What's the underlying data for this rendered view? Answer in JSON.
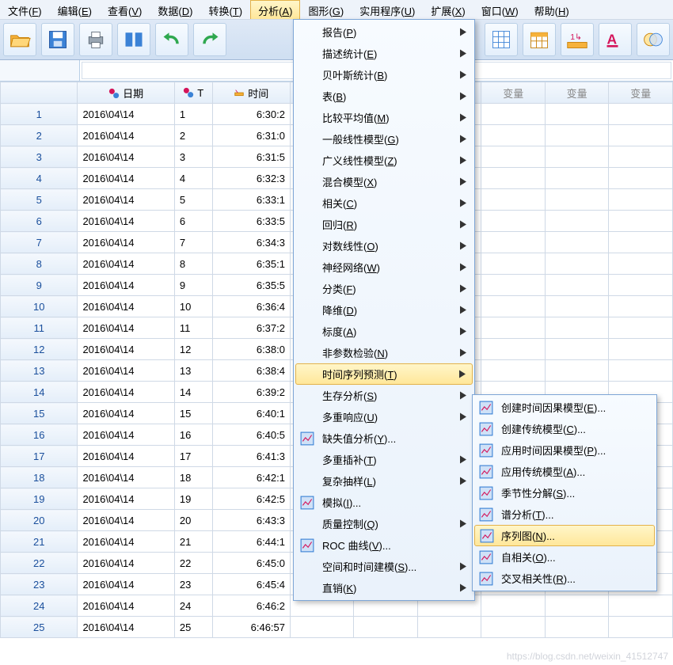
{
  "menubar": [
    {
      "label": "文件(",
      "key": "F",
      "tail": ")"
    },
    {
      "label": "编辑(",
      "key": "E",
      "tail": ")"
    },
    {
      "label": "查看(",
      "key": "V",
      "tail": ")"
    },
    {
      "label": "数据(",
      "key": "D",
      "tail": ")"
    },
    {
      "label": "转换(",
      "key": "T",
      "tail": ")"
    },
    {
      "label": "分析(",
      "key": "A",
      "tail": ")",
      "open": true
    },
    {
      "label": "图形(",
      "key": "G",
      "tail": ")"
    },
    {
      "label": "实用程序(",
      "key": "U",
      "tail": ")"
    },
    {
      "label": "扩展(",
      "key": "X",
      "tail": ")"
    },
    {
      "label": "窗口(",
      "key": "W",
      "tail": ")"
    },
    {
      "label": "帮助(",
      "key": "H",
      "tail": ")"
    }
  ],
  "grid": {
    "headers": {
      "date": "日期",
      "t": "T",
      "time": "时间",
      "var": "变量"
    },
    "rows": [
      {
        "n": "1",
        "date": "2016\\04\\14",
        "t": "1",
        "time": "6:30:2"
      },
      {
        "n": "2",
        "date": "2016\\04\\14",
        "t": "2",
        "time": "6:31:0"
      },
      {
        "n": "3",
        "date": "2016\\04\\14",
        "t": "3",
        "time": "6:31:5"
      },
      {
        "n": "4",
        "date": "2016\\04\\14",
        "t": "4",
        "time": "6:32:3"
      },
      {
        "n": "5",
        "date": "2016\\04\\14",
        "t": "5",
        "time": "6:33:1"
      },
      {
        "n": "6",
        "date": "2016\\04\\14",
        "t": "6",
        "time": "6:33:5"
      },
      {
        "n": "7",
        "date": "2016\\04\\14",
        "t": "7",
        "time": "6:34:3"
      },
      {
        "n": "8",
        "date": "2016\\04\\14",
        "t": "8",
        "time": "6:35:1"
      },
      {
        "n": "9",
        "date": "2016\\04\\14",
        "t": "9",
        "time": "6:35:5"
      },
      {
        "n": "10",
        "date": "2016\\04\\14",
        "t": "10",
        "time": "6:36:4"
      },
      {
        "n": "11",
        "date": "2016\\04\\14",
        "t": "11",
        "time": "6:37:2"
      },
      {
        "n": "12",
        "date": "2016\\04\\14",
        "t": "12",
        "time": "6:38:0"
      },
      {
        "n": "13",
        "date": "2016\\04\\14",
        "t": "13",
        "time": "6:38:4"
      },
      {
        "n": "14",
        "date": "2016\\04\\14",
        "t": "14",
        "time": "6:39:2"
      },
      {
        "n": "15",
        "date": "2016\\04\\14",
        "t": "15",
        "time": "6:40:1"
      },
      {
        "n": "16",
        "date": "2016\\04\\14",
        "t": "16",
        "time": "6:40:5"
      },
      {
        "n": "17",
        "date": "2016\\04\\14",
        "t": "17",
        "time": "6:41:3"
      },
      {
        "n": "18",
        "date": "2016\\04\\14",
        "t": "18",
        "time": "6:42:1"
      },
      {
        "n": "19",
        "date": "2016\\04\\14",
        "t": "19",
        "time": "6:42:5"
      },
      {
        "n": "20",
        "date": "2016\\04\\14",
        "t": "20",
        "time": "6:43:3"
      },
      {
        "n": "21",
        "date": "2016\\04\\14",
        "t": "21",
        "time": "6:44:1"
      },
      {
        "n": "22",
        "date": "2016\\04\\14",
        "t": "22",
        "time": "6:45:0"
      },
      {
        "n": "23",
        "date": "2016\\04\\14",
        "t": "23",
        "time": "6:45:4"
      },
      {
        "n": "24",
        "date": "2016\\04\\14",
        "t": "24",
        "time": "6:46:2"
      },
      {
        "n": "25",
        "date": "2016\\04\\14",
        "t": "25",
        "time": "6:46:57"
      }
    ]
  },
  "menu_analyze": [
    {
      "label": "报告(",
      "key": "P",
      "tail": ")",
      "sub": true
    },
    {
      "label": "描述统计(",
      "key": "E",
      "tail": ")",
      "sub": true
    },
    {
      "label": "贝叶斯统计(",
      "key": "B",
      "tail": ")",
      "sub": true
    },
    {
      "label": "表(",
      "key": "B",
      "tail": ")",
      "sub": true
    },
    {
      "label": "比较平均值(",
      "key": "M",
      "tail": ")",
      "sub": true
    },
    {
      "label": "一般线性模型(",
      "key": "G",
      "tail": ")",
      "sub": true
    },
    {
      "label": "广义线性模型(",
      "key": "Z",
      "tail": ")",
      "sub": true
    },
    {
      "label": "混合模型(",
      "key": "X",
      "tail": ")",
      "sub": true
    },
    {
      "label": "相关(",
      "key": "C",
      "tail": ")",
      "sub": true
    },
    {
      "label": "回归(",
      "key": "R",
      "tail": ")",
      "sub": true
    },
    {
      "label": "对数线性(",
      "key": "O",
      "tail": ")",
      "sub": true
    },
    {
      "label": "神经网络(",
      "key": "W",
      "tail": ")",
      "sub": true
    },
    {
      "label": "分类(",
      "key": "F",
      "tail": ")",
      "sub": true
    },
    {
      "label": "降维(",
      "key": "D",
      "tail": ")",
      "sub": true
    },
    {
      "label": "标度(",
      "key": "A",
      "tail": ")",
      "sub": true
    },
    {
      "label": "非参数检验(",
      "key": "N",
      "tail": ")",
      "sub": true
    },
    {
      "label": "时间序列预测(",
      "key": "T",
      "tail": ")",
      "sub": true,
      "hover": true
    },
    {
      "label": "生存分析(",
      "key": "S",
      "tail": ")",
      "sub": true
    },
    {
      "label": "多重响应(",
      "key": "U",
      "tail": ")",
      "sub": true
    },
    {
      "label": "缺失值分析(",
      "key": "Y",
      "tail": ")...",
      "icon": "missing"
    },
    {
      "label": "多重插补(",
      "key": "T",
      "tail": ")",
      "sub": true
    },
    {
      "label": "复杂抽样(",
      "key": "L",
      "tail": ")",
      "sub": true
    },
    {
      "label": "模拟(",
      "key": "I",
      "tail": ")...",
      "icon": "sim"
    },
    {
      "label": "质量控制(",
      "key": "Q",
      "tail": ")",
      "sub": true
    },
    {
      "label": "ROC 曲线(",
      "key": "V",
      "tail": ")...",
      "icon": "roc"
    },
    {
      "label": "空间和时间建模(",
      "key": "S",
      "tail": ")...",
      "sub": true
    },
    {
      "label": "直销(",
      "key": "K",
      "tail": ")",
      "sub": true
    }
  ],
  "menu_time": [
    {
      "label": "创建时间因果模型(",
      "key": "E",
      "tail": ")...",
      "icon": "tc1"
    },
    {
      "label": "创建传统模型(",
      "key": "C",
      "tail": ")...",
      "icon": "tc2"
    },
    {
      "label": "应用时间因果模型(",
      "key": "P",
      "tail": ")...",
      "icon": "tc3"
    },
    {
      "label": "应用传统模型(",
      "key": "A",
      "tail": ")...",
      "icon": "tc4"
    },
    {
      "label": "季节性分解(",
      "key": "S",
      "tail": ")...",
      "icon": "tc5"
    },
    {
      "label": "谱分析(",
      "key": "T",
      "tail": ")...",
      "icon": "tc6"
    },
    {
      "label": "序列图(",
      "key": "N",
      "tail": ")...",
      "icon": "tc7",
      "hover": true
    },
    {
      "label": "自相关(",
      "key": "O",
      "tail": ")...",
      "icon": "tc8"
    },
    {
      "label": "交叉相关性(",
      "key": "R",
      "tail": ")...",
      "icon": "tc9"
    }
  ],
  "watermark": "https://blog.csdn.net/weixin_41512747"
}
